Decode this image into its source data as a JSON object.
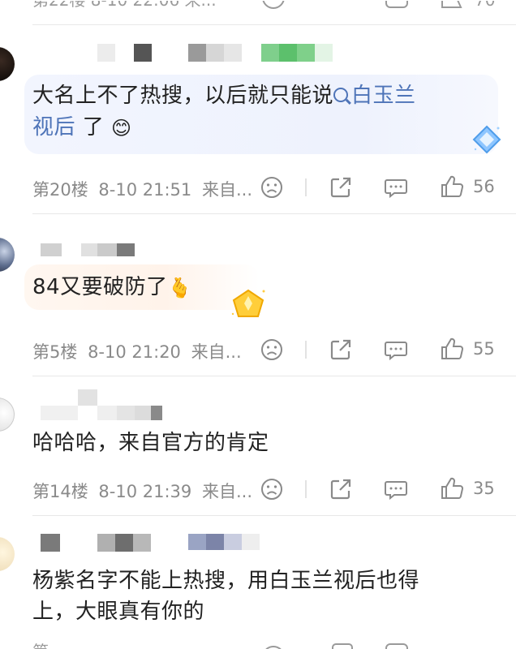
{
  "comments": [
    {
      "floor": "第20楼",
      "date": "8-10 21:51",
      "source": "来自...",
      "text_line1": "大名上不了热搜，以后就只能说",
      "hashtag_line1": "白玉兰",
      "hashtag_line2": "视后",
      "text_line2_after": " 了",
      "emoji": "😊",
      "likes": "56"
    },
    {
      "floor": "第5楼",
      "date": "8-10 21:20",
      "source": "来自...",
      "text_line1": "84又要破防了",
      "emoji": "🫰",
      "likes": "55"
    },
    {
      "floor": "第14楼",
      "date": "8-10 21:39",
      "source": "来自...",
      "text_line1": "哈哈哈，来自官方的肯定",
      "likes": "35"
    },
    {
      "text_line1": "杨紫名字不能上热搜，用白玉兰视后也得",
      "text_line2": "上，大眼真有你的"
    }
  ],
  "icons": {
    "dislike": "frown-face-icon",
    "share": "share-icon",
    "reply": "comment-icon",
    "like": "thumbs-up-icon"
  },
  "colors": {
    "text": "#222222",
    "meta": "#8a8a8a",
    "hashtag": "#4e74b8",
    "divider": "#e8e8e8"
  }
}
